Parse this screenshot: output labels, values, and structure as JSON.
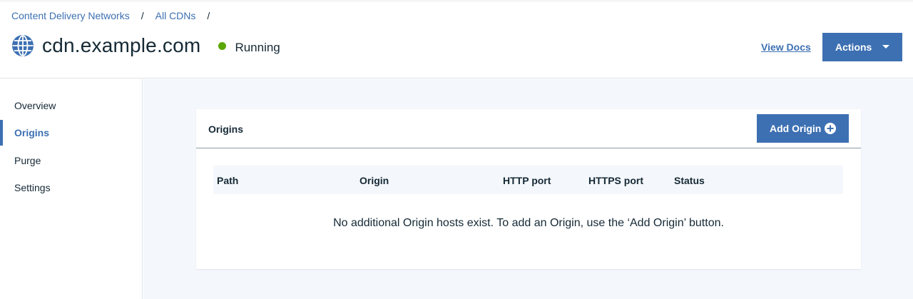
{
  "breadcrumb": {
    "items": [
      "Content Delivery Networks",
      "All CDNs"
    ],
    "separator": "/"
  },
  "header": {
    "title": "cdn.example.com",
    "icon": "globe-icon",
    "status": {
      "label": "Running",
      "color": "#5aa700"
    },
    "view_docs_label": "View Docs",
    "actions_label": "Actions"
  },
  "sidebar": {
    "items": [
      {
        "label": "Overview",
        "active": false
      },
      {
        "label": "Origins",
        "active": true
      },
      {
        "label": "Purge",
        "active": false
      },
      {
        "label": "Settings",
        "active": false
      }
    ]
  },
  "origins_card": {
    "title": "Origins",
    "add_button_label": "Add Origin",
    "add_button_icon": "plus-circle-icon",
    "columns": [
      "Path",
      "Origin",
      "HTTP port",
      "HTTPS port",
      "Status"
    ],
    "rows": [],
    "empty_message": "No additional Origin hosts exist. To add an Origin, use the ‘Add Origin’ button."
  },
  "colors": {
    "accent": "#3d70b2",
    "text": "#152935",
    "background": "#f4f7fb",
    "status_running": "#5aa700"
  }
}
